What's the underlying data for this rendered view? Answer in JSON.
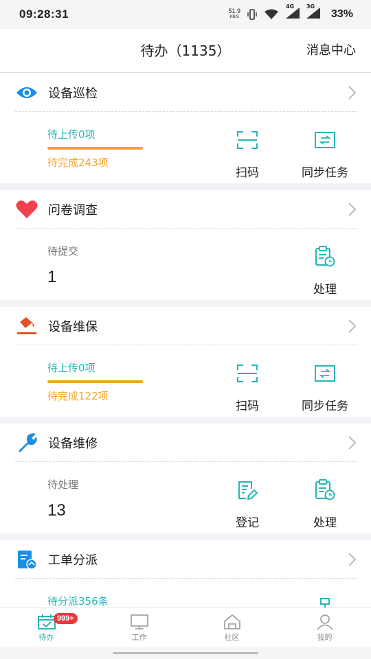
{
  "status": {
    "time": "09:28:31",
    "net_speed_value": "51.9",
    "net_speed_unit": "KB/S",
    "sig1": "4G",
    "sig2": "3G",
    "battery": "33%"
  },
  "header": {
    "title": "待办（1135）",
    "action": "消息中心"
  },
  "cards": [
    {
      "title": "设备巡检",
      "icon": "eye-icon",
      "upload": "待上传0项",
      "done": "待完成243项",
      "actions": [
        "扫码",
        "同步任务"
      ]
    },
    {
      "title": "问卷调查",
      "icon": "heart-icon",
      "label": "待提交",
      "num": "1",
      "actions": [
        "处理"
      ]
    },
    {
      "title": "设备维保",
      "icon": "paint-bucket-icon",
      "upload": "待上传0项",
      "done": "待完成122项",
      "actions": [
        "扫码",
        "同步任务"
      ]
    },
    {
      "title": "设备维修",
      "icon": "wrench-icon",
      "label": "待处理",
      "num": "13",
      "actions": [
        "登记",
        "处理"
      ]
    },
    {
      "title": "工单分派",
      "icon": "work-order-icon",
      "upload": "待分派356条"
    }
  ],
  "tabbar": {
    "badge": "999+",
    "items": [
      {
        "label": "待办",
        "icon": "calendar-check-icon",
        "active": true
      },
      {
        "label": "工作",
        "icon": "monitor-icon"
      },
      {
        "label": "社区",
        "icon": "house-icon"
      },
      {
        "label": "我的",
        "icon": "user-icon"
      }
    ]
  },
  "colors": {
    "accent": "#26b5b7",
    "warning": "#f5a623",
    "badge": "#e8383b",
    "heart": "#f0424f",
    "icon_blue": "#1a8fe3",
    "bucket": "#e0522a"
  }
}
